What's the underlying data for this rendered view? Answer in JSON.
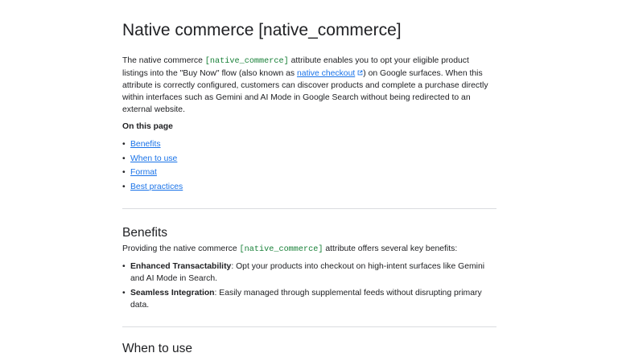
{
  "title": "Native commerce [native_commerce]",
  "intro": {
    "part1": "The native commerce ",
    "code": "[native_commerce]",
    "part2": " attribute enables you to opt your eligible product listings into the \"Buy Now\" flow (also known as ",
    "link": "native checkout",
    "part3": ") on Google surfaces. When this attribute is correctly configured, customers can discover products and complete a purchase directly within interfaces such as Gemini and AI Mode in Google Search without being redirected to an external website."
  },
  "toc": {
    "heading": "On this page",
    "items": [
      "Benefits",
      "When to use",
      "Format",
      "Best practices"
    ]
  },
  "benefits": {
    "heading": "Benefits",
    "intro_part1": "Providing the native commerce ",
    "intro_code": "[native_commerce]",
    "intro_part2": " attribute offers several key benefits:",
    "items": [
      {
        "term": "Enhanced Transactability",
        "text": ": Opt your products into checkout on high-intent surfaces like Gemini and AI Mode in Search."
      },
      {
        "term": "Seamless Integration",
        "text": ": Easily managed through supplemental feeds without disrupting primary data."
      }
    ]
  },
  "next_heading": "When to use",
  "icons": {
    "external_link": "external-link-icon"
  },
  "colors": {
    "link": "#1a73e8",
    "code": "#188038",
    "divider": "#dadce0",
    "text": "#202124"
  }
}
